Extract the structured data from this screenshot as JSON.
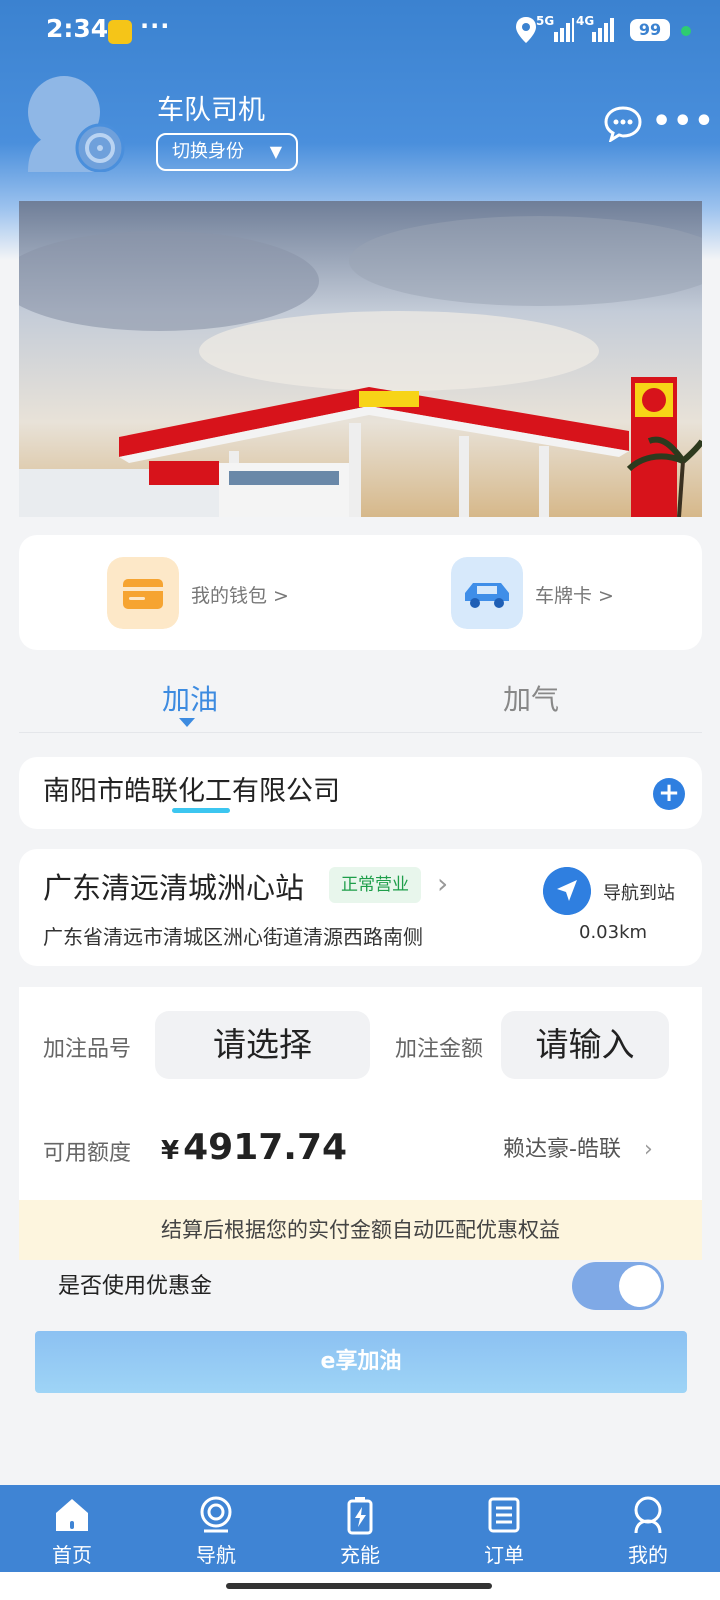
{
  "status_bar": {
    "time": "2:34",
    "more": "···",
    "net1": "5G",
    "net2": "4G",
    "battery": "99"
  },
  "profile": {
    "role": "车队司机",
    "switch_label": "切换身份"
  },
  "quick_actions": [
    {
      "label": "我的钱包 >",
      "icon": "wallet-icon"
    },
    {
      "label": "车牌卡 >",
      "icon": "car-icon"
    }
  ],
  "tabs": [
    {
      "label": "加油",
      "active": true
    },
    {
      "label": "加气",
      "active": false
    }
  ],
  "company": {
    "name": "南阳市皓联化工有限公司",
    "add": "+"
  },
  "station": {
    "name": "广东清远清城洲心站",
    "status": "正常营业",
    "address": "广东省清远市清城区洲心街道清源西路南侧",
    "nav_label": "导航到站",
    "distance": "0.03km"
  },
  "fuel_form": {
    "grade_label": "加注品号",
    "grade_value": "请选择",
    "amount_label": "加注金额",
    "amount_value": "请输入",
    "credit_label": "可用额度",
    "credit_currency": "¥",
    "credit_value": "4917.74",
    "account": "赖达豪-皓联"
  },
  "notice": "结算后根据您的实付金额自动匹配优惠权益",
  "coupon": {
    "label": "是否使用优惠金",
    "enabled": true
  },
  "cta": "e享加油",
  "bottom_nav": [
    {
      "label": "首页",
      "icon": "home-icon"
    },
    {
      "label": "导航",
      "icon": "navigation-icon"
    },
    {
      "label": "充能",
      "icon": "charge-icon"
    },
    {
      "label": "订单",
      "icon": "order-icon"
    },
    {
      "label": "我的",
      "icon": "profile-icon"
    }
  ],
  "colors": {
    "header_blue": "#3b82d0",
    "accent_blue": "#3d8be0",
    "status_green": "#1e9e4a",
    "notice_bg": "#fdf5de"
  }
}
